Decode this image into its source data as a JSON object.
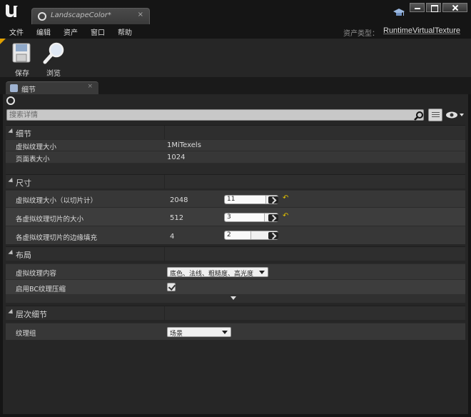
{
  "window": {
    "tab_title": "LandscapeColor*",
    "tab_close": "×"
  },
  "menu": {
    "items": [
      "文件",
      "编辑",
      "资产",
      "窗口",
      "帮助"
    ],
    "asset_type_label": "资产类型：",
    "asset_type_value": "RuntimeVirtualTexture"
  },
  "toolbar": {
    "save_label": "保存",
    "browse_label": "浏览"
  },
  "details_tab": {
    "label": "细节",
    "close": "×"
  },
  "search": {
    "placeholder": "搜索详情"
  },
  "sections": {
    "details": {
      "title": "细节",
      "rows": [
        {
          "name": "虚拟纹理大小",
          "value": "1MiTexels"
        },
        {
          "name": "页面表大小",
          "value": "1024"
        }
      ]
    },
    "size": {
      "title": "尺寸",
      "rows": [
        {
          "name": "虚拟纹理大小（以切片计）",
          "value": "2048",
          "stepper": "11",
          "stepper_fill": 0.79
        },
        {
          "name": "各虚拟纹理切片的大小",
          "value": "512",
          "stepper": "3",
          "stepper_fill": 0.76
        },
        {
          "name": "各虚拟纹理切片的边缘填充",
          "value": "4",
          "stepper": "2",
          "stepper_fill": 0.5
        }
      ],
      "reset_glyph": "↶"
    },
    "layout": {
      "title": "布局",
      "rows": [
        {
          "name": "虚拟纹理内容",
          "value": "底色、法线、粗糙度、高光度"
        },
        {
          "name": "启用BC纹理压缩",
          "checked": true
        }
      ]
    },
    "lod": {
      "title": "层次细节",
      "rows": [
        {
          "name": "纹理组",
          "value": "场景"
        }
      ]
    }
  },
  "colors": {
    "accent_yellow": "#e0c000",
    "background": "#262626"
  }
}
